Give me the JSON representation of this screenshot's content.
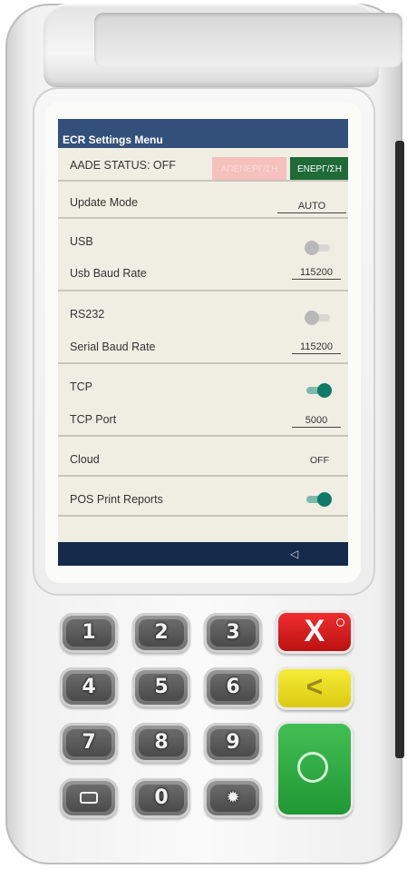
{
  "screen": {
    "title": "ECR Settings Menu",
    "aade": {
      "label": "AADE STATUS: OFF",
      "btn_disable": "ΑΠΕΝΕΡΓ/ΣΗ",
      "btn_enable": "ΕΝΕΡΓ/ΣΗ"
    },
    "update_mode": {
      "label": "Update Mode",
      "value": "AUTO"
    },
    "usb": {
      "label": "USB",
      "toggle": "off",
      "baud_label": "Usb Baud Rate",
      "baud_value": "115200"
    },
    "rs232": {
      "label": "RS232",
      "toggle": "off",
      "baud_label": "Serial Baud Rate",
      "baud_value": "115200"
    },
    "tcp": {
      "label": "TCP",
      "toggle": "on",
      "port_label": "TCP Port",
      "port_value": "5000"
    },
    "cloud": {
      "label": "Cloud",
      "value": "OFF"
    },
    "pos_print": {
      "label": "POS Print Reports",
      "toggle": "on"
    },
    "nav": {
      "back_icon": "back-triangle-icon"
    }
  },
  "device": {
    "keys": [
      "1",
      "2",
      "3",
      "4",
      "5",
      "6",
      "7",
      "8",
      "9",
      "menu",
      "0",
      "settings"
    ],
    "function_keys": {
      "cancel": "X",
      "back": "<",
      "ok": "O"
    },
    "colors": {
      "cancel": "#e52222",
      "back": "#f0e22a",
      "ok": "#2fae42",
      "title_bar": "#33507a",
      "nav_bar": "#15294a",
      "toggle_on": "#0e7a68"
    }
  }
}
